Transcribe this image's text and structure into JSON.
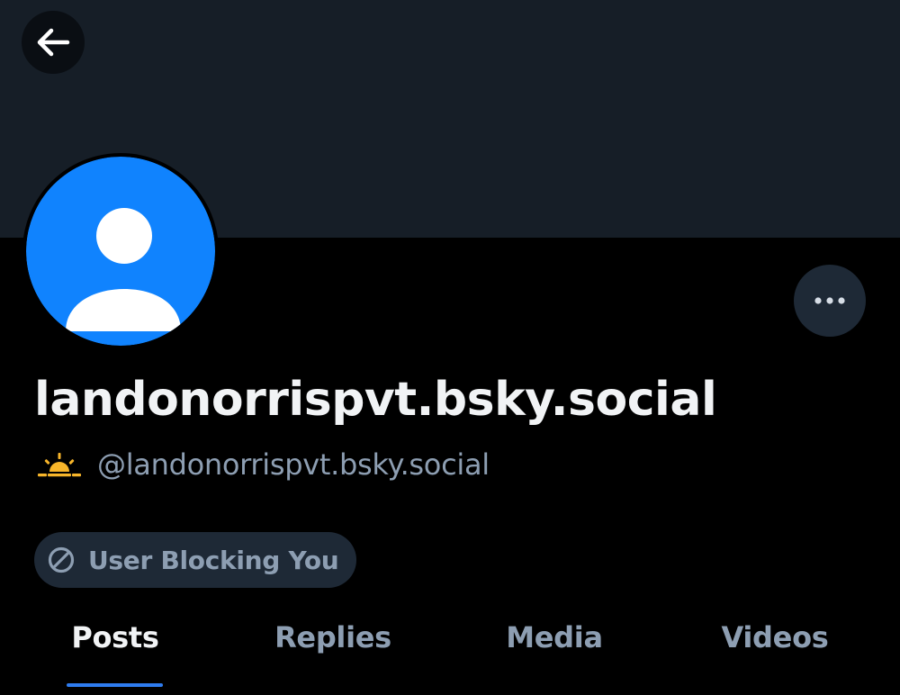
{
  "header": {
    "back_icon": "arrow-left-icon",
    "banner_color": "#161e27"
  },
  "profile": {
    "avatar_icon": "default-user-avatar-icon",
    "avatar_color": "#1083fe",
    "more_icon": "ellipsis-icon",
    "display_name": "landonorrispvt.bsky.social",
    "handle_emoji_icon": "sunrise-icon",
    "handle": "@landonorrispvt.bsky.social",
    "block_badge": {
      "icon": "block-icon",
      "label": "User Blocking You"
    }
  },
  "tabs": [
    {
      "label": "Posts",
      "active": true
    },
    {
      "label": "Replies",
      "active": false
    },
    {
      "label": "Media",
      "active": false
    },
    {
      "label": "Videos",
      "active": false
    }
  ],
  "colors": {
    "accent": "#2e7cf0",
    "muted_text": "#8d9eb2",
    "primary_text": "#f1f3f5",
    "chip_background": "#1e2936"
  }
}
